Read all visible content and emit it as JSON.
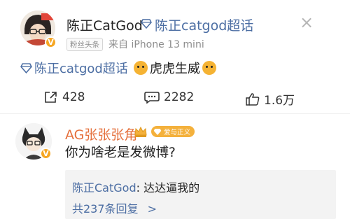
{
  "post": {
    "author": "陈正CatGod",
    "author_badge_icon": "diamond-icon",
    "topic_link": "陈正catgod超话",
    "fan_tag": "粉丝头条",
    "source": "来自 iPhone 13 mini",
    "content_link": "陈正catgod超话",
    "content_text": "虎虎生威",
    "close_glyph": "×"
  },
  "stats": {
    "reposts": "428",
    "comments": "2282",
    "likes": "1.6万"
  },
  "comment": {
    "author": "AG张张张角",
    "badge_text": "爱与正义",
    "text": "你为啥老是发微博?",
    "reply_author": "陈正CatGod",
    "reply_text": ": 达达逼我的",
    "more_replies": "共237条回复",
    "more_arrow": ">"
  },
  "colors": {
    "link": "#4c6ea3",
    "verified": "#f6a623",
    "badge": "#f4b13c"
  }
}
